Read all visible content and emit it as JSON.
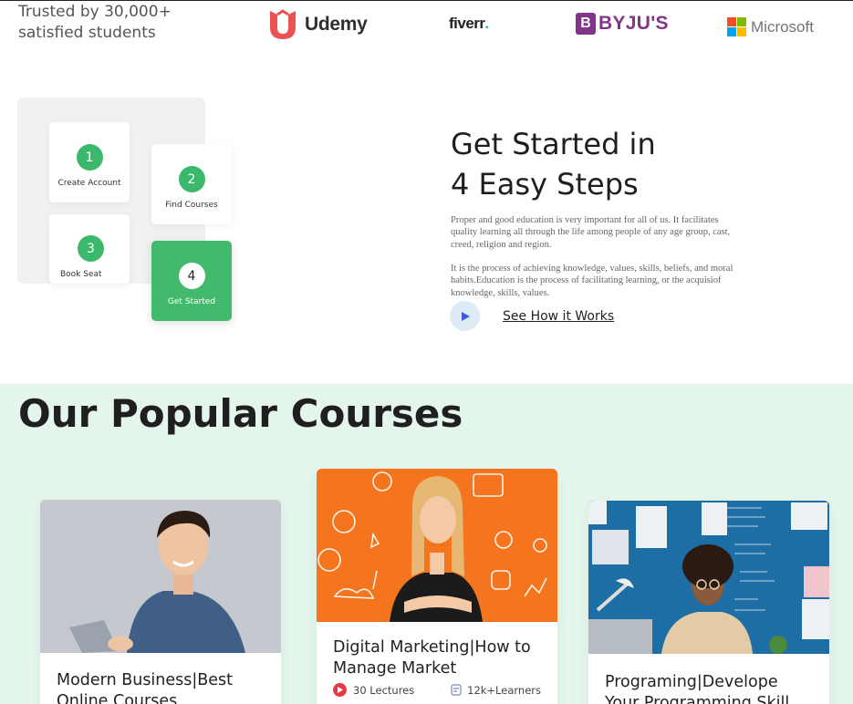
{
  "trusted": {
    "line1": "Trusted by 30,000+",
    "line2": "satisfied students"
  },
  "partners": {
    "udemy": "Udemy",
    "fiverr": "fiverr",
    "fiverr_dot": ".",
    "byjus_mark": "B",
    "byjus": "BYJU'S",
    "microsoft": "Microsoft"
  },
  "steps": [
    {
      "number": "1",
      "label": "Create Account"
    },
    {
      "number": "2",
      "label": "Find Courses"
    },
    {
      "number": "3",
      "label": "Book Seat"
    },
    {
      "number": "4",
      "label": "Get Started"
    }
  ],
  "get_started": {
    "title_line1": "Get Started in",
    "title_line2": "4 Easy Steps",
    "para1": "Proper and good education is very important for all of us. It facilitates quality learning all through the life among people of any age group, cast, creed, religion and region.",
    "para2": "It is the process of achieving knowledge, values, skills, beliefs, and moral habits.Education is the process of facilitating learning, or the acquisiof knowledge, skills, values.",
    "link": "See How it Works"
  },
  "courses": {
    "heading": "Our Popular Courses",
    "items": [
      {
        "title": "Modern Business|Best Online Courses"
      },
      {
        "title": "Digital Marketing|How to Manage Market",
        "lectures": "30 Lectures",
        "learners": "12k+Learners"
      },
      {
        "title": "Programing|Develope Your Programming Skill"
      }
    ]
  },
  "colors": {
    "green": "#43b96c",
    "mint_bg": "#e4f5ec",
    "udemy": "#ec5252",
    "byjus": "#813588",
    "orange": "#f5751f"
  },
  "icons": [
    "udemy-logo-icon",
    "microsoft-logo-icon",
    "play-icon",
    "lecture-play-icon",
    "learners-icon"
  ]
}
